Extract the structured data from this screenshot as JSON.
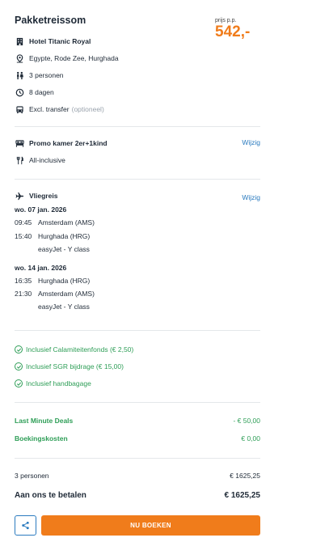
{
  "header": {
    "title": "Pakketreissom",
    "price_label": "prijs p.p.",
    "price": "542,-"
  },
  "package": {
    "hotel": "Hotel Titanic Royal",
    "location": "Egypte, Rode Zee, Hurghada",
    "persons": "3 personen",
    "duration": "8 dagen",
    "transfer": "Excl. transfer",
    "transfer_note": "(optioneel)"
  },
  "room": {
    "name": "Promo kamer 2er+1kind",
    "board": "All-inclusive",
    "edit_label": "Wijzig"
  },
  "flight": {
    "title": "Vliegreis",
    "edit_label": "Wijzig",
    "outbound": {
      "date": "wo. 07 jan. 2026",
      "dep_time": "09:45",
      "dep_airport": "Amsterdam (AMS)",
      "arr_time": "15:40",
      "arr_airport": "Hurghada (HRG)",
      "carrier": "easyJet - Y class"
    },
    "return": {
      "date": "wo. 14 jan. 2026",
      "dep_time": "16:35",
      "dep_airport": "Hurghada (HRG)",
      "arr_time": "21:30",
      "arr_airport": "Amsterdam (AMS)",
      "carrier": "easyJet - Y class"
    }
  },
  "inclusions": [
    "Inclusief Calamiteitenfonds (€ 2,50)",
    "Inclusief SGR bijdrage (€ 15,00)",
    "Inclusief handbagage"
  ],
  "discounts": [
    {
      "label": "Last Minute Deals",
      "amount": "- € 50,00"
    },
    {
      "label": "Boekingskosten",
      "amount": "€ 0,00"
    }
  ],
  "totals": {
    "persons_label": "3 personen",
    "persons_amount": "€ 1625,25",
    "pay_label": "Aan ons te betalen",
    "pay_amount": "€ 1625,25"
  },
  "actions": {
    "book_label": "NU BOEKEN"
  },
  "colors": {
    "accent": "#f07c1b",
    "link": "#2b7bbf",
    "green": "#2e9e57"
  }
}
